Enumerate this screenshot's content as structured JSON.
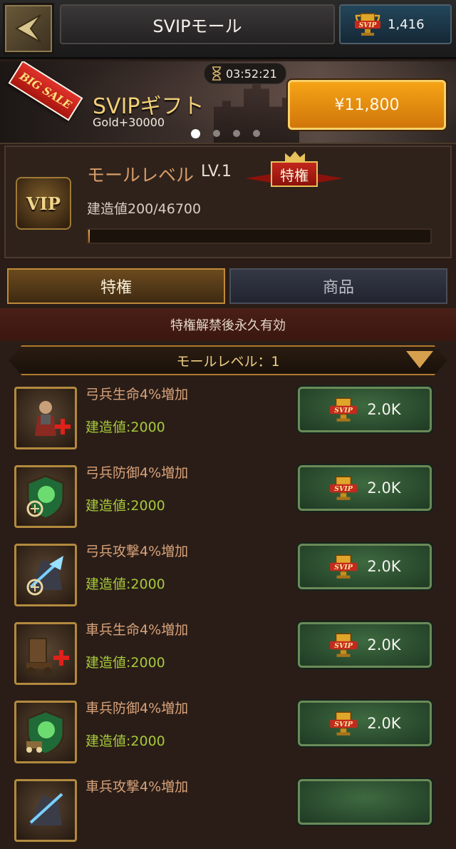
{
  "header": {
    "title": "SVIPモール",
    "currency_amount": "1,416",
    "currency_icon": "svip-trophy-icon"
  },
  "banner": {
    "sale_label": "BIG SALE",
    "timer": "03:52:21",
    "title": "SVIPギフト",
    "subtitle": "Gold+30000",
    "price": "¥11,800",
    "carousel_active": 1,
    "carousel_total": 4
  },
  "level": {
    "label": "モールレベル",
    "value": "LV.1",
    "privilege_badge": "特権",
    "vip_badge": "VIP",
    "build_text": "建造値200/46700",
    "progress": 0.0043
  },
  "tabs": [
    {
      "label": "特権",
      "active": true
    },
    {
      "label": "商品",
      "active": false
    }
  ],
  "notice": "特権解禁後永久有効",
  "section": {
    "title": "モールレベル：1"
  },
  "items": [
    {
      "name": "弓兵生命4%増加",
      "cost": "建造値:2000",
      "price": "2.0K",
      "icon": "archer-health-icon"
    },
    {
      "name": "弓兵防御4%増加",
      "cost": "建造値:2000",
      "price": "2.0K",
      "icon": "archer-defense-icon"
    },
    {
      "name": "弓兵攻撃4%増加",
      "cost": "建造値:2000",
      "price": "2.0K",
      "icon": "archer-attack-icon"
    },
    {
      "name": "車兵生命4%増加",
      "cost": "建造値:2000",
      "price": "2.0K",
      "icon": "siege-health-icon"
    },
    {
      "name": "車兵防御4%増加",
      "cost": "建造値:2000",
      "price": "2.0K",
      "icon": "siege-defense-icon"
    },
    {
      "name": "車兵攻撃4%増加",
      "cost": "",
      "price": "",
      "icon": "siege-attack-icon"
    }
  ],
  "colors": {
    "accent_gold": "#f1cf78",
    "price_orange": "#f6a316",
    "cost_green": "#a6c93a",
    "item_name": "#d7a27a"
  }
}
